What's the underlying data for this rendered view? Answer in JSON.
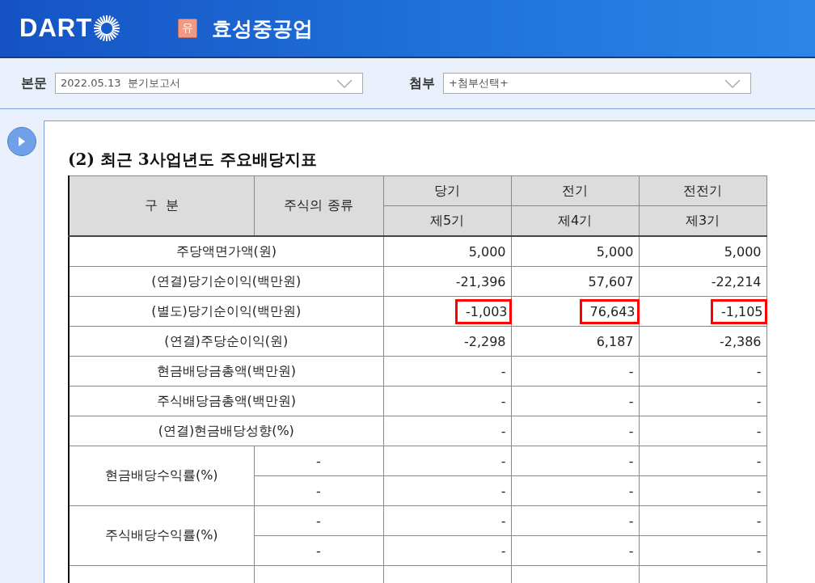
{
  "header": {
    "logo_text": "DART",
    "badge": "유",
    "company": "효성중공업"
  },
  "toolbar": [
    {
      "label": "본문",
      "value": "2022.05.13  분기보고서"
    },
    {
      "label": "첨부",
      "value": "+첨부선택+"
    }
  ],
  "section_title": "(2) 최근 3사업년도 주요배당지표",
  "table": {
    "columns": [
      {
        "label": "구  분"
      },
      {
        "label": "주식의 종류"
      },
      {
        "label": "당기",
        "sub": "제5기"
      },
      {
        "label": "전기",
        "sub": "제4기"
      },
      {
        "label": "전전기",
        "sub": "제3기"
      }
    ],
    "rows": [
      {
        "label": "주당액면가액(원)",
        "lines": [
          {
            "values": [
              {
                "text": "5,000",
                "highlighted": false
              },
              {
                "text": "5,000",
                "highlighted": false
              },
              {
                "text": "5,000",
                "highlighted": false
              }
            ]
          }
        ]
      },
      {
        "label": "(연결)당기순이익(백만원)",
        "lines": [
          {
            "values": [
              {
                "text": "-21,396",
                "highlighted": false
              },
              {
                "text": "57,607",
                "highlighted": false
              },
              {
                "text": "-22,214",
                "highlighted": false
              }
            ]
          }
        ]
      },
      {
        "label": "(별도)당기순이익(백만원)",
        "lines": [
          {
            "values": [
              {
                "text": "-1,003",
                "highlighted": true
              },
              {
                "text": "76,643",
                "highlighted": true
              },
              {
                "text": "-1,105",
                "highlighted": true
              }
            ]
          }
        ]
      },
      {
        "label": "(연결)주당순이익(원)",
        "lines": [
          {
            "values": [
              {
                "text": "-2,298",
                "highlighted": false
              },
              {
                "text": "6,187",
                "highlighted": false
              },
              {
                "text": "-2,386",
                "highlighted": false
              }
            ]
          }
        ]
      },
      {
        "label": "현금배당금총액(백만원)",
        "lines": [
          {
            "values": [
              {
                "text": "-",
                "highlighted": false
              },
              {
                "text": "-",
                "highlighted": false
              },
              {
                "text": "-",
                "highlighted": false
              }
            ]
          }
        ]
      },
      {
        "label": "주식배당금총액(백만원)",
        "lines": [
          {
            "values": [
              {
                "text": "-",
                "highlighted": false
              },
              {
                "text": "-",
                "highlighted": false
              },
              {
                "text": "-",
                "highlighted": false
              }
            ]
          }
        ]
      },
      {
        "label": "(연결)현금배당성향(%)",
        "lines": [
          {
            "values": [
              {
                "text": "-",
                "highlighted": false
              },
              {
                "text": "-",
                "highlighted": false
              },
              {
                "text": "-",
                "highlighted": false
              }
            ]
          }
        ]
      },
      {
        "label": "현금배당수익률(%)",
        "lines": [
          {
            "type": "-",
            "values": [
              {
                "text": "-",
                "highlighted": false
              },
              {
                "text": "-",
                "highlighted": false
              },
              {
                "text": "-",
                "highlighted": false
              }
            ]
          },
          {
            "type": "-",
            "values": [
              {
                "text": "-",
                "highlighted": false
              },
              {
                "text": "-",
                "highlighted": false
              },
              {
                "text": "-",
                "highlighted": false
              }
            ]
          }
        ]
      },
      {
        "label": "주식배당수익률(%)",
        "lines": [
          {
            "type": "-",
            "values": [
              {
                "text": "-",
                "highlighted": false
              },
              {
                "text": "-",
                "highlighted": false
              },
              {
                "text": "-",
                "highlighted": false
              }
            ]
          },
          {
            "type": "-",
            "values": [
              {
                "text": "-",
                "highlighted": false
              },
              {
                "text": "-",
                "highlighted": false
              },
              {
                "text": "-",
                "highlighted": false
              }
            ]
          }
        ]
      }
    ]
  }
}
